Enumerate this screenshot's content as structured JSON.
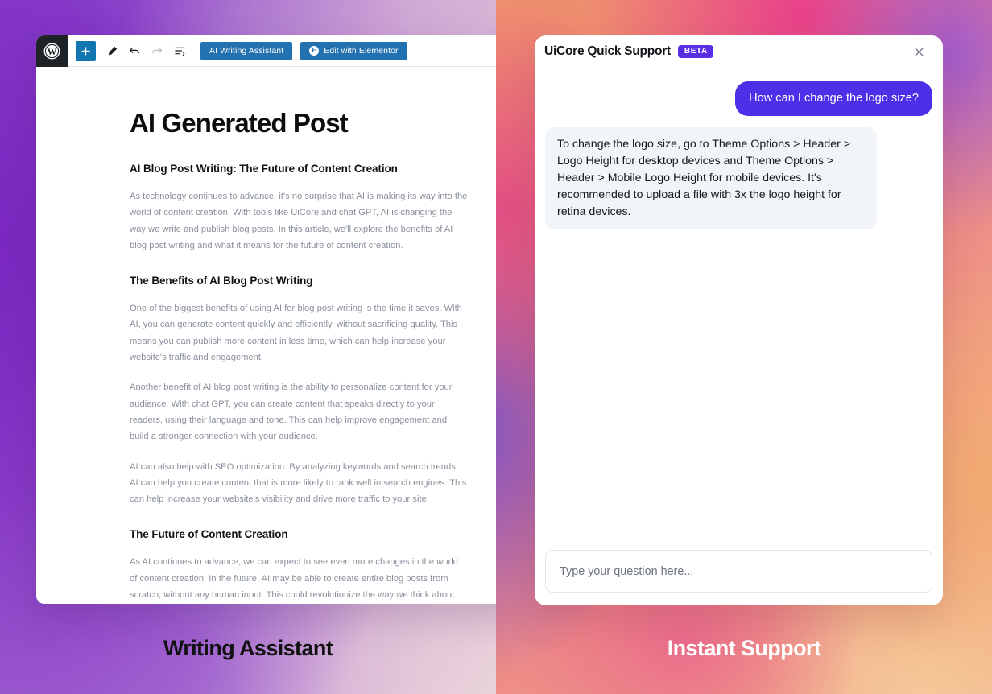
{
  "left_panel": {
    "caption": "Writing Assistant",
    "editor": {
      "logo_icon": "wordpress-logo-icon",
      "toolbar": {
        "add_block_label": "+",
        "add_block_icon": "plus-icon",
        "edit_tool_icon": "pencil-icon",
        "undo_icon": "undo-arrow-icon",
        "redo_icon": "redo-arrow-icon",
        "list_view_icon": "document-outline-icon",
        "ai_writing_assistant_label": "AI Writing Assistant",
        "edit_with_elementor_label": "Edit with Elementor",
        "elementor_badge_letter": "E",
        "elementor_icon": "elementor-circle-icon"
      },
      "post": {
        "title": "AI Generated Post",
        "blocks": [
          {
            "type": "heading",
            "text": "AI Blog Post Writing: The Future of Content Creation"
          },
          {
            "type": "paragraph",
            "text": "As technology continues to advance, it's no surprise that AI is making its way into the world of content creation. With tools like UiCore and chat GPT, AI is changing the way we write and publish blog posts. In this article, we'll explore the benefits of AI blog post writing and what it means for the future of content creation."
          },
          {
            "type": "heading",
            "text": "The Benefits of AI Blog Post Writing"
          },
          {
            "type": "paragraph",
            "text": "One of the biggest benefits of using AI for blog post writing is the time it saves. With AI, you can generate content quickly and efficiently, without sacrificing quality. This means you can publish more content in less time, which can help increase your website's traffic and engagement."
          },
          {
            "type": "paragraph",
            "text": "Another benefit of AI blog post writing is the ability to personalize content for your audience. With chat GPT, you can create content that speaks directly to your readers, using their language and tone. This can help improve engagement and build a stronger connection with your audience."
          },
          {
            "type": "paragraph",
            "text": "AI can also help with SEO optimization. By analyzing keywords and search trends, AI can help you create content that is more likely to rank well in search engines. This can help increase your website's visibility and drive more traffic to your site."
          },
          {
            "type": "heading",
            "text": "The Future of Content Creation"
          },
          {
            "type": "paragraph",
            "text": "As AI continues to advance, we can expect to see even more changes in the world of content creation. In the future, AI may be able to create entire blog posts from scratch, without any human input. This could revolutionize the way we think about content creation and open up new possibilities for businesses and individuals alike."
          }
        ]
      }
    }
  },
  "right_panel": {
    "caption": "Instant Support",
    "chat": {
      "title": "UiCore Quick Support",
      "badge": "BETA",
      "close_icon": "close-x-icon",
      "messages": [
        {
          "role": "user",
          "text": "How can I change the logo size?"
        },
        {
          "role": "bot",
          "text": "To change the logo size, go to Theme Options > Header > Logo Height for desktop devices and Theme Options > Header > Mobile Logo Height for mobile devices. It's recommended to upload a file with 3x the logo height for retina devices."
        }
      ],
      "input": {
        "value": "",
        "placeholder": "Type your question here..."
      }
    }
  },
  "colors": {
    "wp_toolbar_blue": "#2271b1",
    "wp_add_block_blue": "#1277b0",
    "wp_logo_dark": "#1d2327",
    "chat_user_bubble": "#4f2ee8",
    "chat_bot_bubble": "#f1f4f8",
    "beta_badge": "#5a2ee5",
    "left_gradient_start": "#6d21b8",
    "left_gradient_end": "#edd9dd",
    "right_gradient_start": "#ef8f6e",
    "right_gradient_end": "#f2b994",
    "body_text": "#8b919c"
  }
}
